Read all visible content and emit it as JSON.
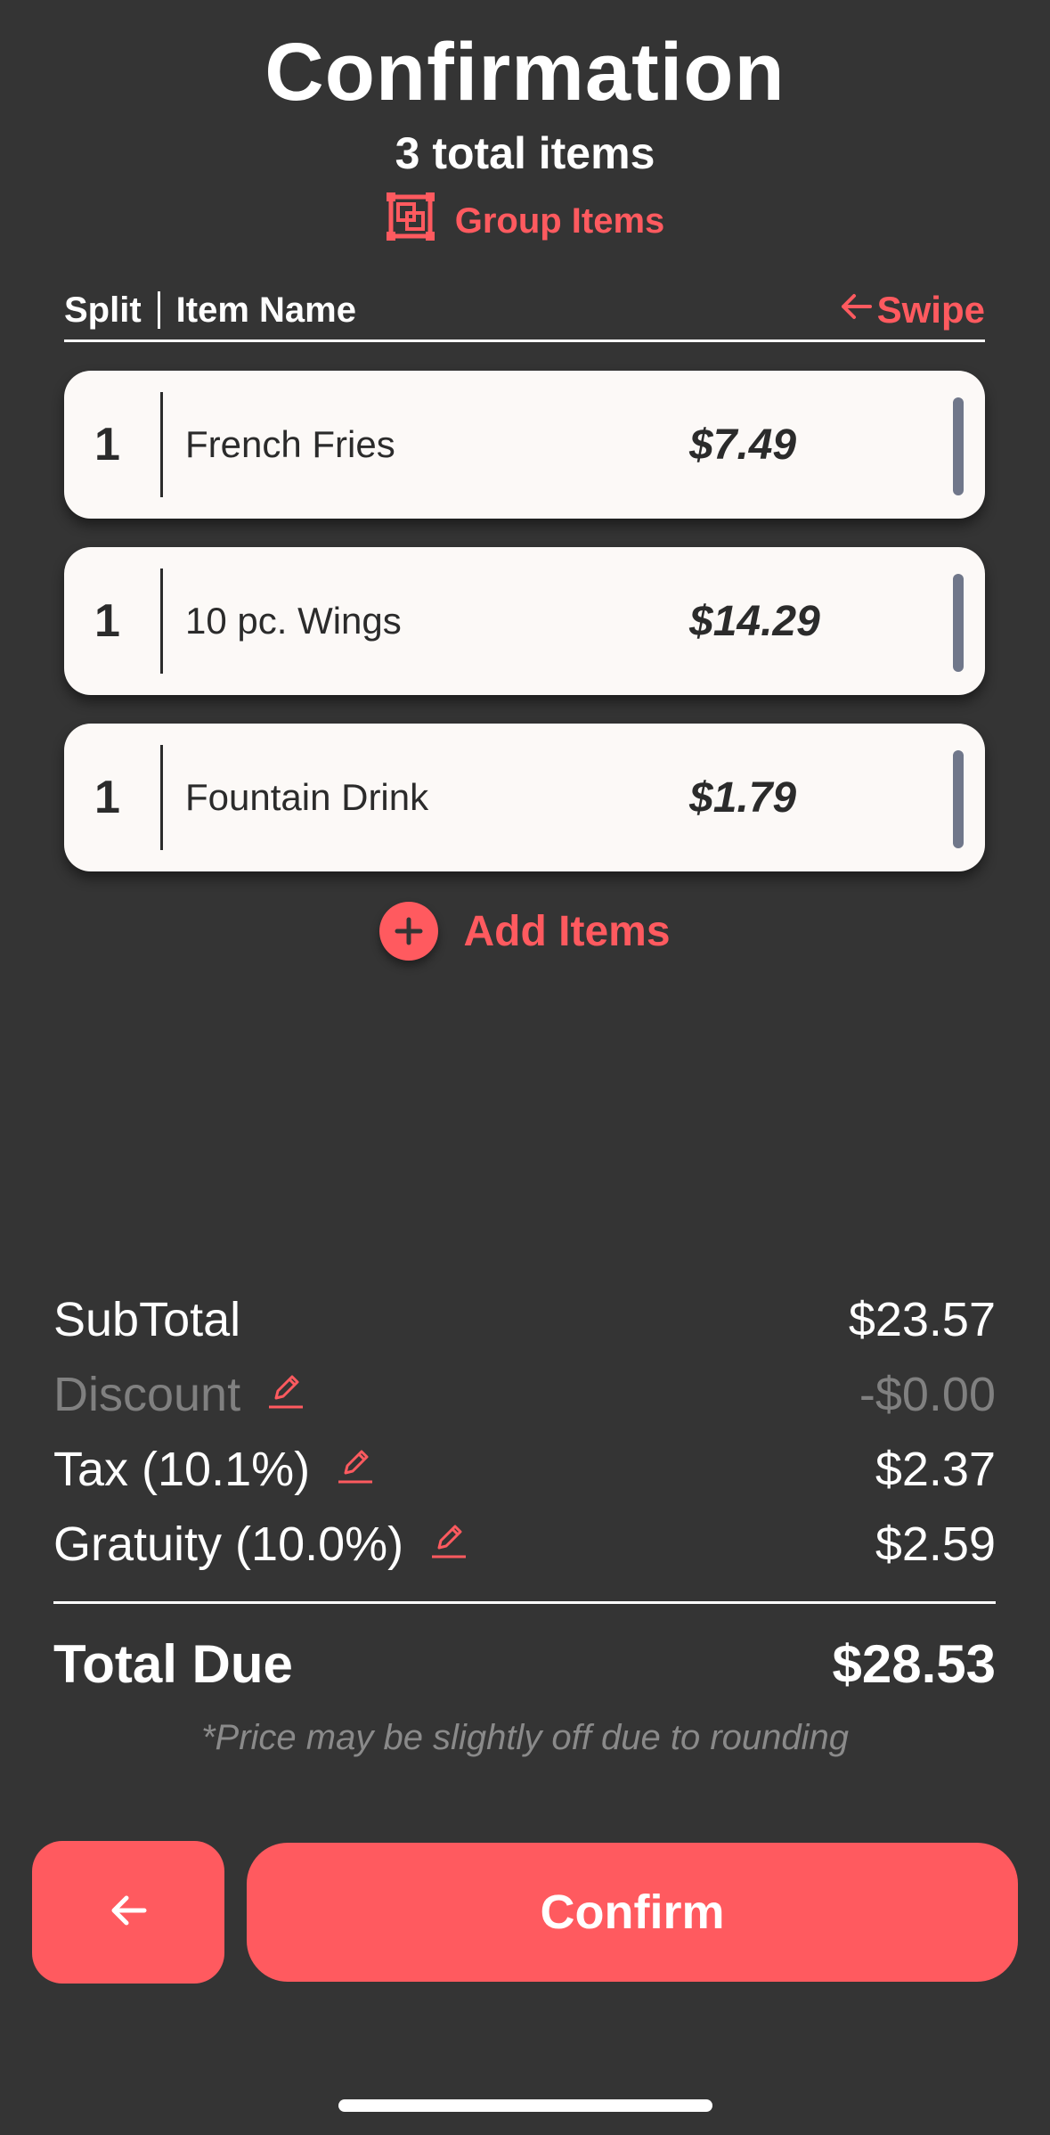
{
  "header": {
    "title": "Confirmation",
    "subtitle": "3 total items",
    "group_label": "Group Items"
  },
  "columns": {
    "split": "Split",
    "item_name": "Item Name",
    "swipe": "Swipe"
  },
  "items": [
    {
      "qty": "1",
      "name": "French Fries",
      "price": "$7.49"
    },
    {
      "qty": "1",
      "name": "10 pc. Wings",
      "price": "$14.29"
    },
    {
      "qty": "1",
      "name": "Fountain Drink",
      "price": "$1.79"
    }
  ],
  "add_items_label": "Add Items",
  "summary": {
    "subtotal_label": "SubTotal",
    "subtotal_value": "$23.57",
    "discount_label": "Discount",
    "discount_value": "-$0.00",
    "tax_label": "Tax (10.1%)",
    "tax_value": "$2.37",
    "gratuity_label": "Gratuity (10.0%)",
    "gratuity_value": "$2.59",
    "total_label": "Total Due",
    "total_value": "$28.53",
    "note": "*Price may be slightly off due to rounding"
  },
  "buttons": {
    "confirm_label": "Confirm"
  },
  "icons": {
    "group": "group-items-icon",
    "swipe": "arrow-left-icon",
    "add": "plus-circle-icon",
    "edit": "pencil-icon",
    "back": "arrow-left-icon"
  },
  "colors": {
    "background": "#343434",
    "accent": "#FF5A5F",
    "card": "#FCF9F7",
    "handle": "#70778A",
    "muted": "#808080"
  }
}
